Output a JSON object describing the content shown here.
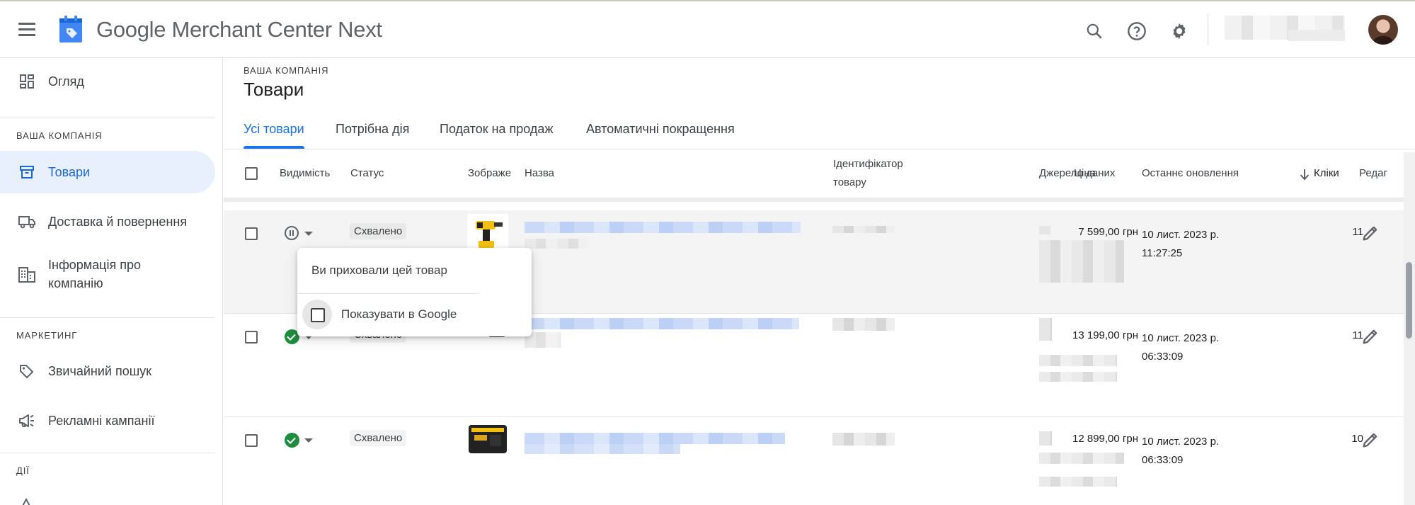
{
  "app": {
    "title": "Google Merchant Center Next"
  },
  "topbar": {
    "search_icon": "search-icon",
    "help_icon": "help-icon",
    "settings_icon": "gear-icon"
  },
  "sidebar": {
    "overview": "Огляд",
    "section_company": "ВАША КОМПАНІЯ",
    "products": "Товари",
    "shipping": "Доставка й повернення",
    "company_info": "Інформація про компанію",
    "section_marketing": "МАРКЕТИНГ",
    "free_listings": "Звичайний пошук",
    "campaigns": "Рекламні кампанії",
    "section_actions": "ДІЇ"
  },
  "page": {
    "breadcrumb": "ВАША КОМПАНІЯ",
    "title": "Товари",
    "tabs": [
      "Усі товари",
      "Потрібна дія",
      "Податок на продаж",
      "Автоматичні покращення"
    ],
    "active_tab": 0
  },
  "table": {
    "columns": {
      "visibility": "Видимість",
      "status": "Статус",
      "image": "Зображе",
      "name": "Назва",
      "id_line1": "Ідентифікатор",
      "id_line2": "товару",
      "price": "Ціна",
      "source": "Джерело даних",
      "updated": "Останнє оновлення",
      "clicks": "Кліки",
      "edit": "Редаг"
    },
    "sort_icon": "arrow-down-icon",
    "rows": [
      {
        "visibility": "paused",
        "status": "Схвалено",
        "price": "7 599,00 грн",
        "updated_date": "10 лист. 2023 р.",
        "updated_time": "11:27:25",
        "clicks": "11"
      },
      {
        "visibility": "visible",
        "status": "Схвалено",
        "price": "13 199,00 грн",
        "updated_date": "10 лист. 2023 р.",
        "updated_time": "06:33:09",
        "clicks": "11"
      },
      {
        "visibility": "visible",
        "status": "Схвалено",
        "price": "12 899,00 грн",
        "updated_date": "10 лист. 2023 р.",
        "updated_time": "06:33:09",
        "clicks": "10"
      }
    ]
  },
  "popup": {
    "message": "Ви приховали цей товар",
    "checkbox_label": "Показувати в Google",
    "checked": false
  },
  "colors": {
    "accent": "#1a73e8",
    "active_nav_bg": "#e8f0fe",
    "approved_green": "#1e8e3e"
  }
}
